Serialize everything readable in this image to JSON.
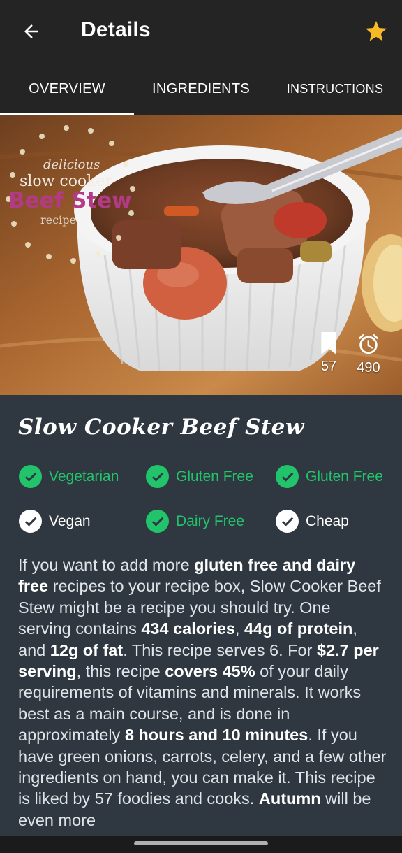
{
  "appbar": {
    "title": "Details",
    "back_icon": "arrow-left-icon",
    "favorite_icon": "star-icon",
    "favorite_color": "#f7b928"
  },
  "tabs": [
    {
      "label": "OVERVIEW",
      "active": true
    },
    {
      "label": "INGREDIENTS",
      "active": false
    },
    {
      "label": "INSTRUCTIONS",
      "active": false
    }
  ],
  "hero": {
    "watermark": {
      "line1": "delicious",
      "line2": "slow cooker",
      "line3": "Beef Stew",
      "line4": "recipe"
    },
    "likes": {
      "icon": "bookmark-icon",
      "value": "57"
    },
    "time": {
      "icon": "alarm-clock-icon",
      "value": "490"
    }
  },
  "recipe": {
    "title": "Slow Cooker Beef Stew",
    "badges": [
      {
        "label": "Vegetarian",
        "checked": true
      },
      {
        "label": "Gluten Free",
        "checked": true
      },
      {
        "label": "Gluten Free",
        "checked": true
      },
      {
        "label": "Vegan",
        "checked": false
      },
      {
        "label": "Dairy Free",
        "checked": true
      },
      {
        "label": "Cheap",
        "checked": false
      }
    ],
    "summary": [
      {
        "t": "If you want to add more ",
        "b": false
      },
      {
        "t": "gluten free and dairy free",
        "b": true
      },
      {
        "t": " recipes to your recipe box, Slow Cooker Beef Stew might be a recipe you should try. One serving contains ",
        "b": false
      },
      {
        "t": "434 calories",
        "b": true
      },
      {
        "t": ", ",
        "b": false
      },
      {
        "t": "44g of protein",
        "b": true
      },
      {
        "t": ", and ",
        "b": false
      },
      {
        "t": "12g of fat",
        "b": true
      },
      {
        "t": ". This recipe serves 6. For ",
        "b": false
      },
      {
        "t": "$2.7 per serving",
        "b": true
      },
      {
        "t": ", this recipe ",
        "b": false
      },
      {
        "t": "covers 45%",
        "b": true
      },
      {
        "t": " of your daily requirements of vitamins and minerals. It works best as a main course, and is done in approximately ",
        "b": false
      },
      {
        "t": "8 hours and 10 minutes",
        "b": true
      },
      {
        "t": ". If you have green onions, carrots, celery, and a few other ingredients on hand, you can make it. This recipe is liked by 57 foodies and cooks. ",
        "b": false
      },
      {
        "t": "Autumn",
        "b": true
      },
      {
        "t": " will be even more",
        "b": false
      }
    ]
  },
  "colors": {
    "appbar_bg": "#242424",
    "content_bg": "#2f3840",
    "check_green": "#22c46b"
  }
}
